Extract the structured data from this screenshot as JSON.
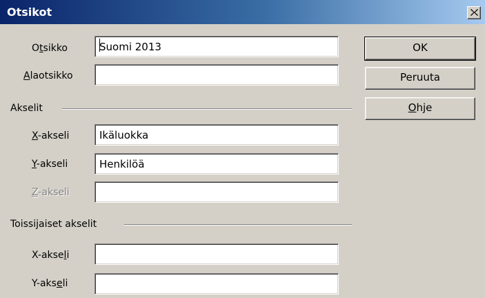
{
  "window": {
    "title": "Otsikot",
    "close_icon": "close-x-icon"
  },
  "fields": {
    "title": {
      "label_pre": "O",
      "label_accel": "t",
      "label_post": "sikko",
      "value": "Suomi 2013"
    },
    "subtitle": {
      "label_pre": "",
      "label_accel": "A",
      "label_post": "laotsikko",
      "value": ""
    }
  },
  "axes_section": {
    "heading": "Akselit",
    "x": {
      "label_pre": "",
      "label_accel": "X",
      "label_post": "-akseli",
      "value": "Ikäluokka"
    },
    "y": {
      "label_pre": "",
      "label_accel": "Y",
      "label_post": "-akseli",
      "value": "Henkilöä"
    },
    "z": {
      "label_pre": "",
      "label_accel": "Z",
      "label_post": "-akseli",
      "value": "",
      "disabled": true
    }
  },
  "secondary_section": {
    "heading": "Toissijaiset akselit",
    "x": {
      "label_pre": "X-akse",
      "label_accel": "l",
      "label_post": "i",
      "value": ""
    },
    "y": {
      "label_pre": "Y-aks",
      "label_accel": "e",
      "label_post": "li",
      "value": ""
    }
  },
  "buttons": {
    "ok": {
      "pre": "",
      "accel": "",
      "post": "OK"
    },
    "cancel": {
      "pre": "",
      "accel": "",
      "post": "Peruuta"
    },
    "help": {
      "pre": "",
      "accel": "O",
      "post": "hje"
    }
  }
}
